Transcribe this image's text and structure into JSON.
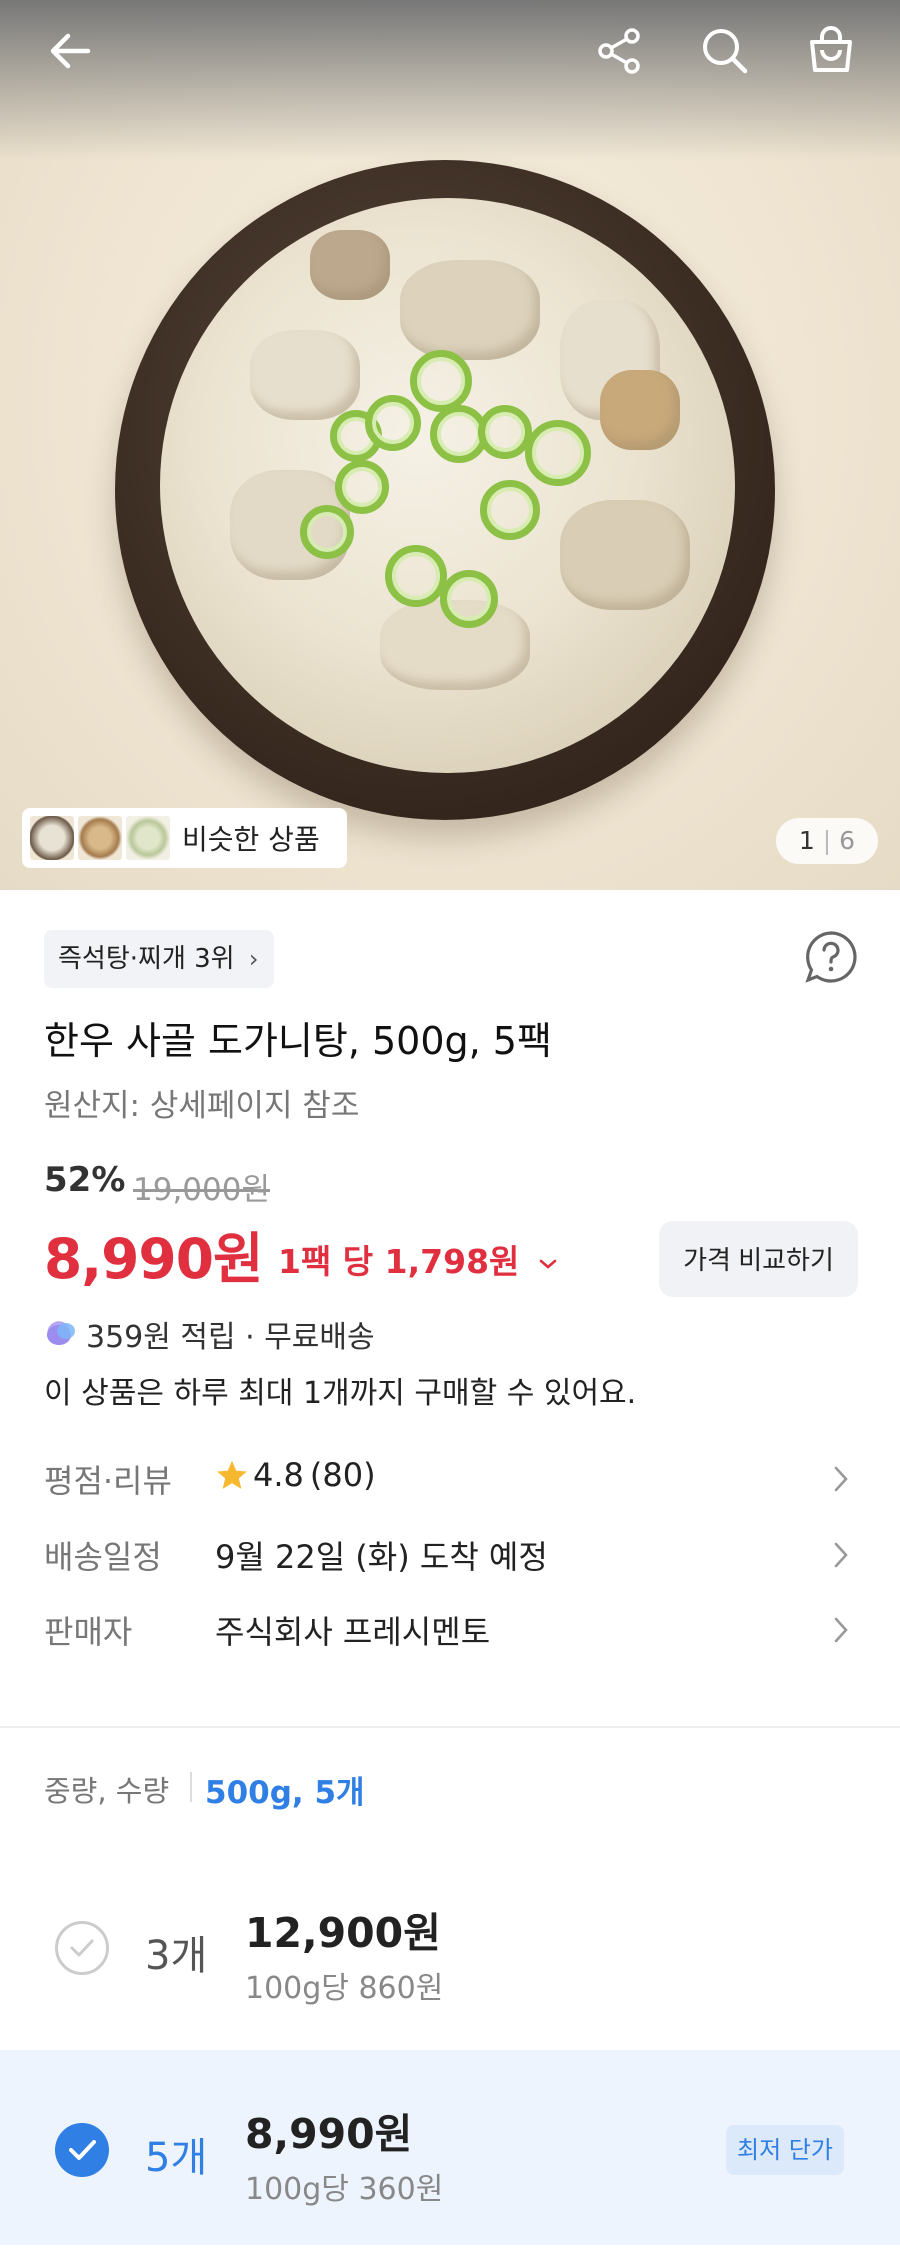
{
  "gallery": {
    "similar_label": "비슷한 상품",
    "current_page": "1",
    "total_pages": "6"
  },
  "product": {
    "rank_label": "즉석탕·찌개 3위",
    "title": "한우 사골 도가니탕, 500g, 5팩",
    "origin": "원산지: 상세페이지 참조",
    "discount": "52%",
    "original_price": "19,000원",
    "price": "8,990원",
    "unit_price": "1팩 당 1,798원",
    "compare_button": "가격 비교하기",
    "points": "359원 적립 · 무료배송",
    "purchase_limit": "이 상품은 하루 최대 1개까지 구매할 수 있어요."
  },
  "details": [
    {
      "label": "평점·리뷰",
      "rating": "4.8",
      "count": "(80)"
    },
    {
      "label": "배송일정",
      "value": "9월 22일 (화) 도착 예정"
    },
    {
      "label": "판매자",
      "value": "주식회사 프레시멘토"
    }
  ],
  "options": {
    "label": "중량, 수량",
    "selected_value": "500g, 5개",
    "items": [
      {
        "qty": "3개",
        "price": "12,900원",
        "per100g": "100g당 860원",
        "selected": false
      },
      {
        "qty": "5개",
        "price": "8,990원",
        "per100g": "100g당 360원",
        "selected": true,
        "badge": "최저 단가"
      }
    ]
  },
  "colors": {
    "accent_red": "#e03040",
    "accent_blue": "#2f7fe4",
    "star": "#f5b82e"
  },
  "icons": [
    "back-arrow-icon",
    "share-icon",
    "search-icon",
    "cart-icon",
    "help-icon",
    "chevron-right-icon",
    "star-icon",
    "points-icon",
    "check-icon"
  ]
}
